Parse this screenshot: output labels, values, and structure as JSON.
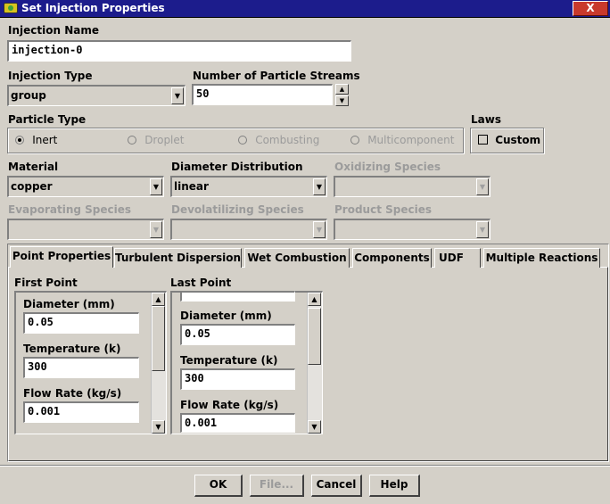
{
  "window": {
    "title": "Set Injection Properties",
    "close_glyph": "X",
    "icon": "fluent-app-icon"
  },
  "injection_name": {
    "label": "Injection Name",
    "value": "injection-0"
  },
  "injection_type": {
    "label": "Injection Type",
    "value": "group"
  },
  "particle_streams": {
    "label": "Number of Particle Streams",
    "value": "50"
  },
  "particle_type": {
    "label": "Particle Type",
    "options": [
      {
        "label": "Inert",
        "selected": true,
        "enabled": true
      },
      {
        "label": "Droplet",
        "selected": false,
        "enabled": false
      },
      {
        "label": "Combusting",
        "selected": false,
        "enabled": false
      },
      {
        "label": "Multicomponent",
        "selected": false,
        "enabled": false
      }
    ]
  },
  "laws": {
    "label": "Laws",
    "custom_label": "Custom",
    "custom_checked": false
  },
  "material": {
    "label": "Material",
    "value": "copper"
  },
  "diameter_distribution": {
    "label": "Diameter Distribution",
    "value": "linear"
  },
  "oxidizing_species": {
    "label": "Oxidizing Species",
    "value": ""
  },
  "evaporating_species": {
    "label": "Evaporating Species",
    "value": ""
  },
  "devolatilizing_species": {
    "label": "Devolatilizing Species",
    "value": ""
  },
  "product_species": {
    "label": "Product Species",
    "value": ""
  },
  "tabs": [
    {
      "label": "Point Properties",
      "active": true
    },
    {
      "label": "Turbulent Dispersion",
      "active": false
    },
    {
      "label": "Wet Combustion",
      "active": false
    },
    {
      "label": "Components",
      "active": false
    },
    {
      "label": "UDF",
      "active": false
    },
    {
      "label": "Multiple Reactions",
      "active": false
    }
  ],
  "first_point": {
    "title": "First Point",
    "diameter_label": "Diameter (mm)",
    "diameter_value": "0.05",
    "temperature_label": "Temperature (k)",
    "temperature_value": "300",
    "flow_rate_label": "Flow Rate (kg/s)",
    "flow_rate_value": "0.001"
  },
  "last_point": {
    "title": "Last Point",
    "diameter_label": "Diameter (mm)",
    "diameter_value": "0.05",
    "temperature_label": "Temperature (k)",
    "temperature_value": "300",
    "flow_rate_label": "Flow Rate (kg/s)",
    "flow_rate_value": "0.001"
  },
  "buttons": {
    "ok": "OK",
    "file": "File...",
    "cancel": "Cancel",
    "help": "Help"
  },
  "glyphs": {
    "down": "▼",
    "up": "▲"
  }
}
